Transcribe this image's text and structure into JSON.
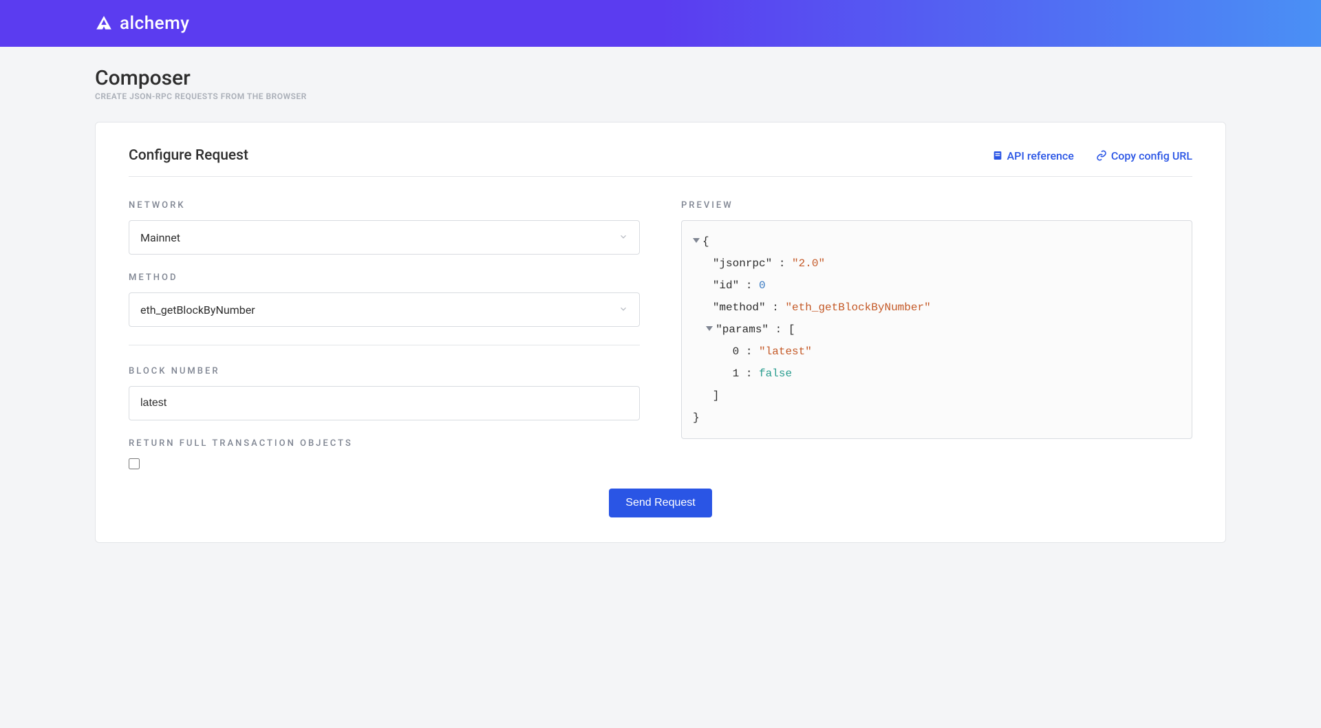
{
  "brand": "alchemy",
  "page": {
    "title": "Composer",
    "subtitle": "CREATE JSON-RPC REQUESTS FROM THE BROWSER"
  },
  "card": {
    "title": "Configure Request",
    "links": {
      "api_reference": "API reference",
      "copy_config": "Copy config URL"
    }
  },
  "form": {
    "network_label": "NETWORK",
    "network_value": "Mainnet",
    "method_label": "METHOD",
    "method_value": "eth_getBlockByNumber",
    "block_number_label": "BLOCK NUMBER",
    "block_number_value": "latest",
    "return_full_label": "RETURN FULL TRANSACTION OBJECTS",
    "return_full_checked": false
  },
  "preview": {
    "label": "PREVIEW",
    "json": {
      "jsonrpc_key": "\"jsonrpc\"",
      "jsonrpc_val": "\"2.0\"",
      "id_key": "\"id\"",
      "id_val": "0",
      "method_key": "\"method\"",
      "method_val": "\"eth_getBlockByNumber\"",
      "params_key": "\"params\"",
      "param0_idx": "0",
      "param0_val": "\"latest\"",
      "param1_idx": "1",
      "param1_val": "false"
    }
  },
  "actions": {
    "send": "Send Request"
  }
}
